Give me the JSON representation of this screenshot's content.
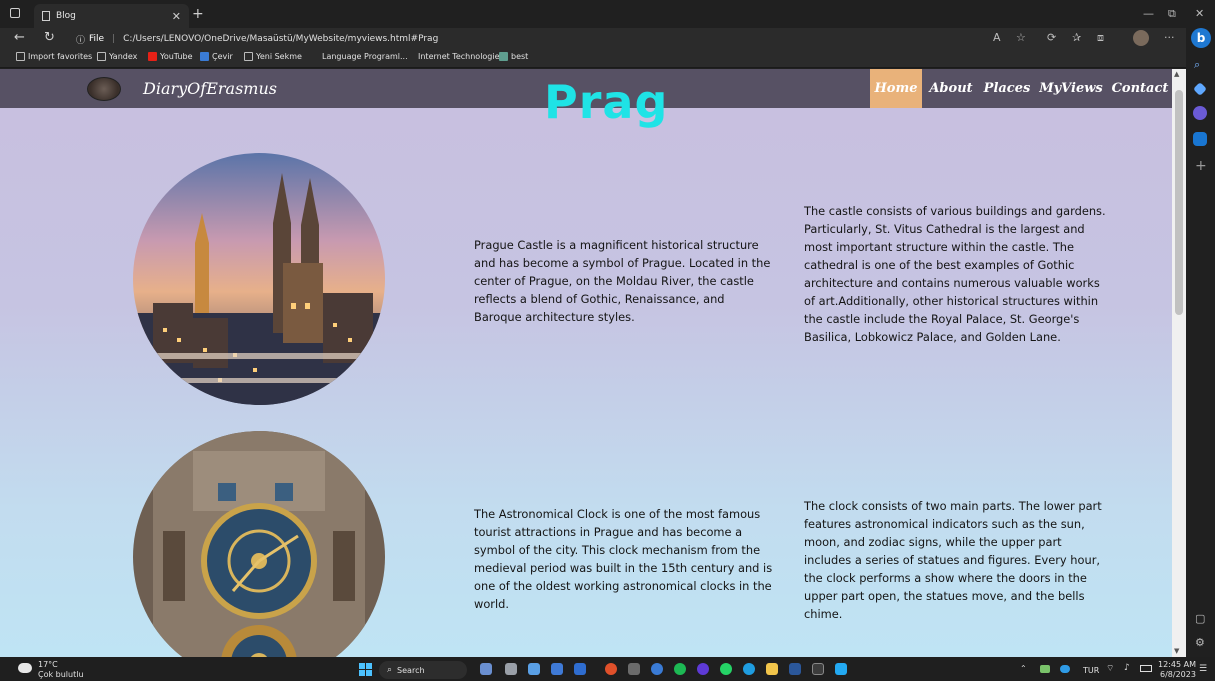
{
  "browser": {
    "tab_title": "Blog",
    "address_prefix": "File",
    "url": "C:/Users/LENOVO/OneDrive/Masaüstü/MyWebsite/myviews.html#Prag",
    "favorites": [
      {
        "label": "Import favorites"
      },
      {
        "label": "Yandex"
      },
      {
        "label": "YouTube"
      },
      {
        "label": "Çevir"
      },
      {
        "label": "Yeni Sekme"
      },
      {
        "label": "Language Programl..."
      },
      {
        "label": "Internet Technologies"
      },
      {
        "label": "best"
      }
    ]
  },
  "site": {
    "brand": "DiaryOfErasmus",
    "nav": [
      "Home",
      "About",
      "Places",
      "MyViews",
      "Contact"
    ],
    "active_nav": "Home",
    "page_title": "Prag",
    "colors": {
      "nav_bg": "#575164",
      "active_bg": "#e9b27a",
      "title": "#1fe3e6"
    }
  },
  "sections": [
    {
      "image_name": "prague-castle-image",
      "left_text": "Prague Castle is a magnificent historical structure and has become a symbol of Prague. Located in the center of Prague, on the Moldau River, the castle reflects a blend of Gothic, Renaissance, and Baroque architecture styles.",
      "right_text": "The castle consists of various buildings and gardens. Particularly, St. Vitus Cathedral is the largest and most important structure within the castle. The cathedral is one of the best examples of Gothic architecture and contains numerous valuable works of art.Additionally, other historical structures within the castle include the Royal Palace, St. George's Basilica, Lobkowicz Palace, and Golden Lane."
    },
    {
      "image_name": "astronomical-clock-image",
      "left_text": "The Astronomical Clock is one of the most famous tourist attractions in Prague and has become a symbol of the city. This clock mechanism from the medieval period was built in the 15th century and is one of the oldest working astronomical clocks in the world.",
      "right_text": "The clock consists of two main parts. The lower part features astronomical indicators such as the sun, moon, and zodiac signs, while the upper part includes a series of statues and figures. Every hour, the clock performs a show where the doors in the upper part open, the statues move, and the bells chime."
    }
  ],
  "taskbar": {
    "weather_temp": "17°C",
    "weather_desc": "Çok bulutlu",
    "search_label": "Search",
    "language": "TUR",
    "time": "12:45 AM",
    "date": "6/8/2023"
  }
}
